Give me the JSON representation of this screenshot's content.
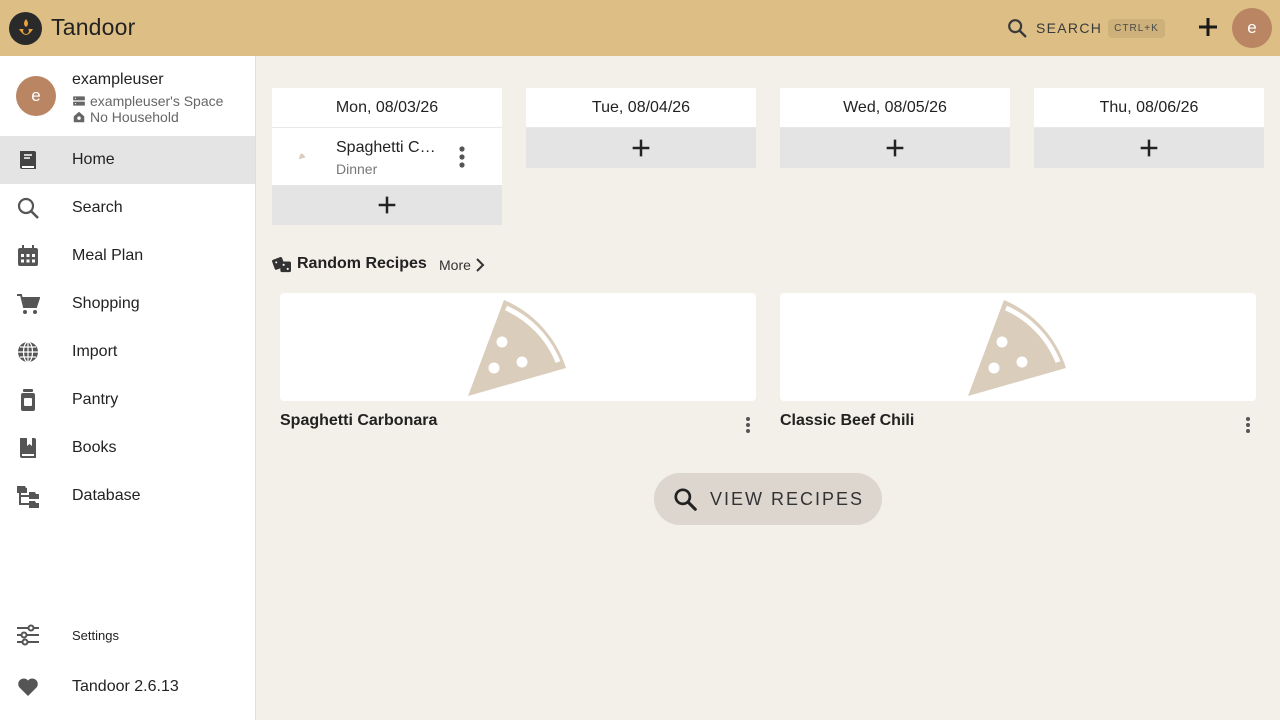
{
  "app": {
    "name": "Tandoor"
  },
  "topbar": {
    "search_label": "SEARCH",
    "search_shortcut": "CTRL+K",
    "avatar_letter": "e"
  },
  "user": {
    "avatar_letter": "e",
    "name": "exampleuser",
    "space": "exampleuser's Space",
    "household": "No Household"
  },
  "sidebar": {
    "items": [
      {
        "label": "Home",
        "icon": "book-icon",
        "active": true
      },
      {
        "label": "Search",
        "icon": "search-icon"
      },
      {
        "label": "Meal Plan",
        "icon": "calendar-icon"
      },
      {
        "label": "Shopping",
        "icon": "cart-icon"
      },
      {
        "label": "Import",
        "icon": "globe-icon"
      },
      {
        "label": "Pantry",
        "icon": "jar-icon"
      },
      {
        "label": "Books",
        "icon": "bookshelf-icon"
      },
      {
        "label": "Database",
        "icon": "database-tree-icon"
      }
    ],
    "settings_label": "Settings",
    "version_label": "Tandoor 2.6.13"
  },
  "meal_plan": {
    "days": [
      {
        "label": "Mon, 08/03/26",
        "entries": [
          {
            "name": "Spaghetti Carbonara",
            "display_name": "Spaghetti C…",
            "type": "Dinner"
          }
        ]
      },
      {
        "label": "Tue, 08/04/26",
        "entries": []
      },
      {
        "label": "Wed, 08/05/26",
        "entries": []
      },
      {
        "label": "Thu, 08/06/26",
        "entries": []
      }
    ]
  },
  "random_recipes": {
    "title": "Random Recipes",
    "more_label": "More",
    "recipes": [
      {
        "name": "Spaghetti Carbonara"
      },
      {
        "name": "Classic Beef Chili"
      }
    ]
  },
  "view_recipes_label": "VIEW RECIPES",
  "colors": {
    "topbar": "#ddbf86",
    "avatar": "#b98563",
    "background": "#f3efe9",
    "placeholder_icon": "#dacdbb"
  }
}
